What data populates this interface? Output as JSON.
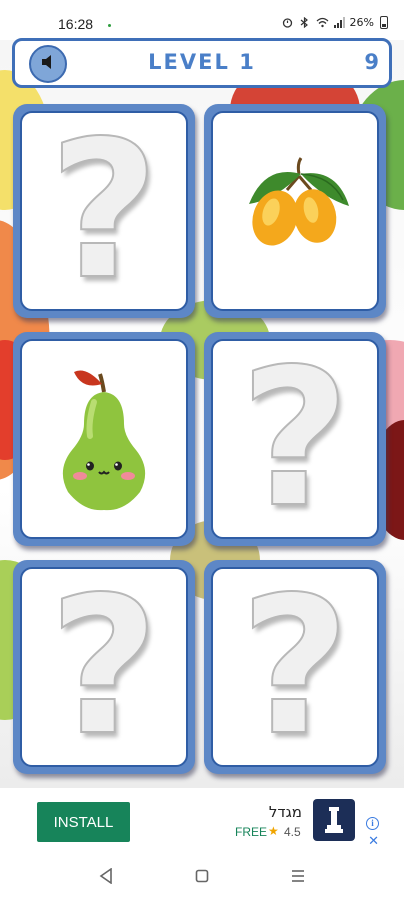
{
  "status_bar": {
    "time": "16:28",
    "battery": "26%",
    "icons": [
      "alarm-icon",
      "bluetooth-icon",
      "wifi-icon",
      "signal-icon",
      "battery-icon"
    ]
  },
  "header": {
    "level": "LEVEL 1",
    "moves": "9",
    "sound_icon": "speaker-muted-icon"
  },
  "cards": [
    {
      "state": "hidden",
      "content": "?"
    },
    {
      "state": "revealed",
      "content": "mango-icon"
    },
    {
      "state": "revealed",
      "content": "pear-icon"
    },
    {
      "state": "hidden",
      "content": "?"
    },
    {
      "state": "hidden",
      "content": "?"
    },
    {
      "state": "hidden",
      "content": "?"
    }
  ],
  "ad": {
    "install_label": "INSTALL",
    "app_name": "מגדל",
    "price": "FREE",
    "rating": "4.5",
    "info_label": "i",
    "close_label": "✕"
  },
  "nav_bar": {
    "items": [
      "back-icon",
      "home-icon",
      "recents-icon"
    ]
  },
  "colors": {
    "card_frame": "#5d87c6",
    "card_border": "#2f5da5",
    "header_text": "#4a7fc8",
    "install_green": "#17845a"
  }
}
